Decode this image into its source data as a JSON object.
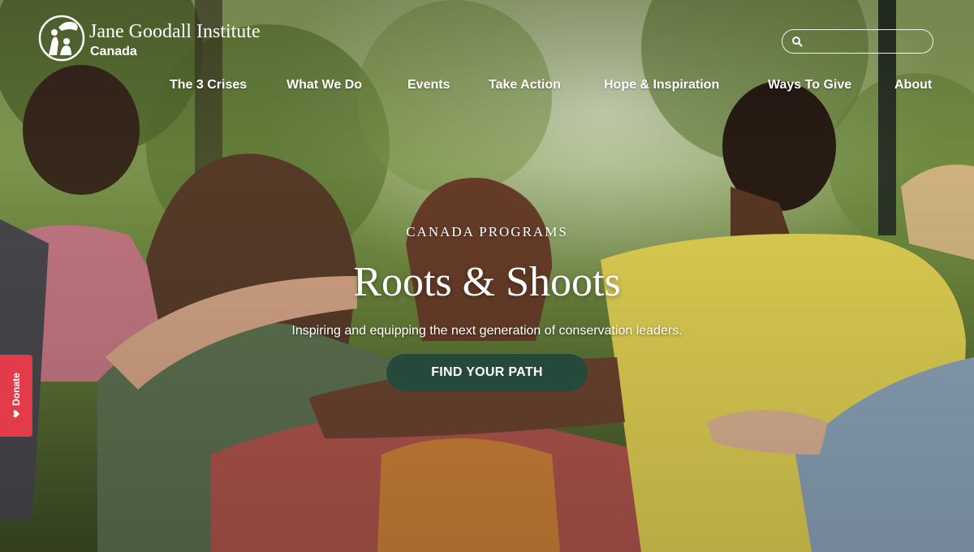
{
  "header": {
    "logo_title": "Jane Goodall Institute",
    "logo_subtitle": "Canada",
    "logo_icon": "chimp-and-person-silhouette-icon",
    "search": {
      "placeholder": "",
      "icon": "search-icon"
    }
  },
  "nav": {
    "items": [
      {
        "label": "The 3 Crises"
      },
      {
        "label": "What We Do"
      },
      {
        "label": "Events"
      },
      {
        "label": "Take Action"
      },
      {
        "label": "Hope & Inspiration"
      },
      {
        "label": "Ways To Give"
      },
      {
        "label": "About"
      }
    ]
  },
  "hero": {
    "eyebrow": "CANADA PROGRAMS",
    "title": "Roots & Shoots",
    "tagline": "Inspiring and equipping the next generation of conservation leaders.",
    "cta_label": "FIND YOUR PATH"
  },
  "donate_tab": {
    "label": "Donate",
    "icon": "heart-icon"
  },
  "colors": {
    "cta_bg": "#254a3c",
    "donate_bg": "#e23b49",
    "text": "#ffffff"
  }
}
